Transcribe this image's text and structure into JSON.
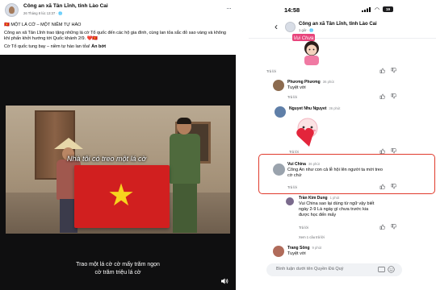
{
  "post": {
    "page_name": "Công an xã Tân Lĩnh, tỉnh Lào Cai",
    "meta": "26 Tháng 8 lúc 13:37 · ",
    "headline": "🇻🇳 MỘT LÁ CỜ – MỘT NIỀM TỰ HÀO",
    "body": "Công an xã Tân Lĩnh trao tặng những lá cờ Tổ quốc đến các hộ gia đình, cùng lan tỏa sắc đỏ sao vàng và không khí phấn khởi hướng tới Quốc khánh 2/9. ❤️🇻🇳",
    "tagline": "Cờ Tổ quốc tung bay – niềm tự hào lan tỏa!",
    "hide_link": "Ẩn bớt"
  },
  "video": {
    "caption_top": "Nhà tôi có treo một lá cờ",
    "caption_bottom_1": "Trao một lá cờ cờ mấy trăm ngọn",
    "caption_bottom_2": "cờ trăm triệu lá cờ"
  },
  "phone": {
    "time": "14:58",
    "battery": "19",
    "thread": {
      "title": "Công an xã Tân Lĩnh, tỉnh Lào Cai",
      "subtitle": "1 giờ · "
    },
    "sticker1_text": "Vui Chưa",
    "reply_label": "Trả lời",
    "comments": [
      {
        "name": "Phương Phương",
        "time": "36 phút",
        "text": "Tuyệt vời"
      },
      {
        "name": "Nguyet Nhu Nguyet",
        "time": "36 phút",
        "text": ""
      },
      {
        "name": "Vui China",
        "time": "36 phút",
        "text": "Công An như con cả lễ hội lên người ta mới treo cờ chứ"
      },
      {
        "name": "Trần Kim Dung",
        "time": "1 phút",
        "text": "Vui China sao lại dùng từ ngữ vậy biết ngày 2-9 Là ngày gì chưa trước kia được học đến mấy"
      },
      {
        "name": "Trang Sông",
        "time": "9 phút",
        "text": "Tuyệt vời"
      }
    ],
    "see_replies": "Xem 1 câu trả lời",
    "composer_placeholder": "Bình luận dưới tên Quyền Đá Quý"
  },
  "colors": {
    "highlight_border": "#e03a2c",
    "flag_red": "#d11f1f",
    "flag_star": "#f7d41e"
  }
}
